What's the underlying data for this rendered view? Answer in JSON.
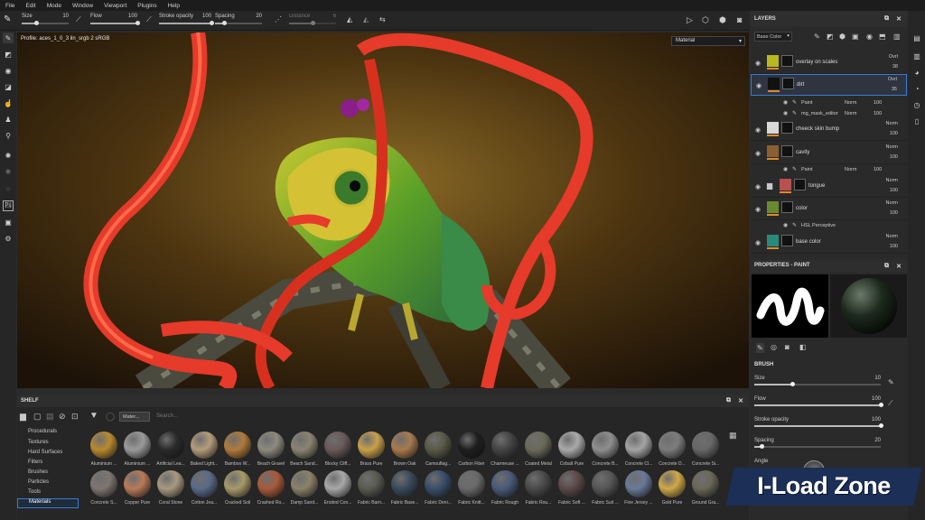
{
  "menu": [
    "File",
    "Edit",
    "Mode",
    "Window",
    "Viewport",
    "Plugins",
    "Help"
  ],
  "toolbar": {
    "sliders": [
      {
        "label": "Size",
        "value": "10",
        "fill": 0.3
      },
      {
        "label": "Flow",
        "value": "100",
        "fill": 1.0
      },
      {
        "label": "Stroke opacity",
        "value": "100",
        "fill": 1.0
      },
      {
        "label": "Spacing",
        "value": "20",
        "fill": 0.2
      },
      {
        "label": "Distance",
        "value": "6",
        "fill": 0.5
      }
    ]
  },
  "viewport": {
    "profile": "Profile: aces_1_0_3 lin_srgb 2 sRGB",
    "material_mode": "Material"
  },
  "shelf": {
    "title": "SHELF",
    "filter_chip": "Mater...",
    "search_placeholder": "Search...",
    "categories": [
      "Procedurals",
      "Textures",
      "Hard Surfaces",
      "Filters",
      "Brushes",
      "Particles",
      "Tools",
      "Materials"
    ],
    "selected_category": "Materials",
    "row1": [
      {
        "name": "Aluminium ...",
        "color": "#b88a2e"
      },
      {
        "name": "Aluminium ...",
        "color": "#9a9a9a"
      },
      {
        "name": "Artificial Lea...",
        "color": "#2a2a2a"
      },
      {
        "name": "Baked Light...",
        "color": "#b49c7a"
      },
      {
        "name": "Bamboo W...",
        "color": "#b07a3c"
      },
      {
        "name": "Beach Gravel",
        "color": "#8c8a80"
      },
      {
        "name": "Beach Sand...",
        "color": "#8a8472"
      },
      {
        "name": "Blocky Cliff...",
        "color": "#6a5a5a"
      },
      {
        "name": "Brass Pure",
        "color": "#c8a04a"
      },
      {
        "name": "Brown Oak",
        "color": "#a87a4e"
      },
      {
        "name": "Camouflag...",
        "color": "#5a5a48"
      },
      {
        "name": "Carbon Fiber",
        "color": "#1e1e1e"
      },
      {
        "name": "Charmeuse ...",
        "color": "#444444"
      },
      {
        "name": "Coated Metal",
        "color": "#6a6a5a"
      },
      {
        "name": "Cobalt Pure",
        "color": "#aaaaaa"
      },
      {
        "name": "Concrete B...",
        "color": "#8e8e8e"
      },
      {
        "name": "Concrete Cl...",
        "color": "#a4a4a4"
      },
      {
        "name": "Concrete D...",
        "color": "#7c7c7c"
      },
      {
        "name": "Concrete Si...",
        "color": "#686868"
      }
    ],
    "row2": [
      {
        "name": "Concrete S...",
        "color": "#7e7670"
      },
      {
        "name": "Copper Pure",
        "color": "#b87a5a"
      },
      {
        "name": "Coral Stone",
        "color": "#a89a80"
      },
      {
        "name": "Cotton Jea...",
        "color": "#5a6a88"
      },
      {
        "name": "Cracked Soil",
        "color": "#a89a6a"
      },
      {
        "name": "Crashed Ro...",
        "color": "#a85a3a"
      },
      {
        "name": "Damp Sand...",
        "color": "#8a8268"
      },
      {
        "name": "Eroded Con...",
        "color": "#a8a8a8"
      },
      {
        "name": "Fabric Barn...",
        "color": "#5a5a52"
      },
      {
        "name": "Fabric Base...",
        "color": "#3a4a5a"
      },
      {
        "name": "Fabric Deni...",
        "color": "#3a4e6a"
      },
      {
        "name": "Fabric Knitt...",
        "color": "#6a6a6a"
      },
      {
        "name": "Fabric Rough",
        "color": "#4a5a7a"
      },
      {
        "name": "Fabric Rou...",
        "color": "#4a4a4a"
      },
      {
        "name": "Fabric Soft ...",
        "color": "#5a4a48"
      },
      {
        "name": "Fabric Suit ...",
        "color": "#565656"
      },
      {
        "name": "Fine Jersey ...",
        "color": "#6a7a98"
      },
      {
        "name": "Gold Pure",
        "color": "#d0a848"
      },
      {
        "name": "Ground Gra...",
        "color": "#6a6858"
      }
    ]
  },
  "layers": {
    "title": "LAYERS",
    "channel": "Base Color",
    "items": [
      {
        "name": "overlay on scales",
        "blend": "Ovrl",
        "opacity": "38",
        "thumb": "#b8b820"
      },
      {
        "name": "dirt",
        "blend": "Ovrl",
        "opacity": "35",
        "thumb": "#111111"
      },
      {
        "name": "cheeck skin bump",
        "blend": "Norm",
        "opacity": "100",
        "thumb": "#d8d8d8"
      },
      {
        "name": "cavity",
        "blend": "Norm",
        "opacity": "100",
        "thumb": "#8a6030"
      },
      {
        "name": "tongue",
        "blend": "Norm",
        "opacity": "100",
        "thumb": "#b85050"
      },
      {
        "name": "color",
        "blend": "Norm",
        "opacity": "100",
        "thumb": "#6a8a30"
      },
      {
        "name": "base color",
        "blend": "Norm",
        "opacity": "100",
        "thumb": "#2a8a7a"
      }
    ],
    "subs": [
      {
        "name": "Paint",
        "blend": "Norm",
        "opacity": "100"
      },
      {
        "name": "mg_mask_editor",
        "blend": "Norm",
        "opacity": "100"
      },
      {
        "name": "Paint",
        "blend": "Norm",
        "opacity": "100"
      },
      {
        "name": "HSL Perceptive",
        "blend": "",
        "opacity": ""
      }
    ]
  },
  "properties": {
    "title": "PROPERTIES - PAINT",
    "brush_title": "BRUSH",
    "sliders": [
      {
        "label": "Size",
        "value": "10",
        "fill": 0.3
      },
      {
        "label": "Flow",
        "value": "100",
        "fill": 1.0
      },
      {
        "label": "Stroke opacity",
        "value": "100",
        "fill": 1.0
      },
      {
        "label": "Spacing",
        "value": "20",
        "fill": 0.06
      }
    ],
    "angle_label": "Angle"
  },
  "watermark": "I-Load Zone"
}
